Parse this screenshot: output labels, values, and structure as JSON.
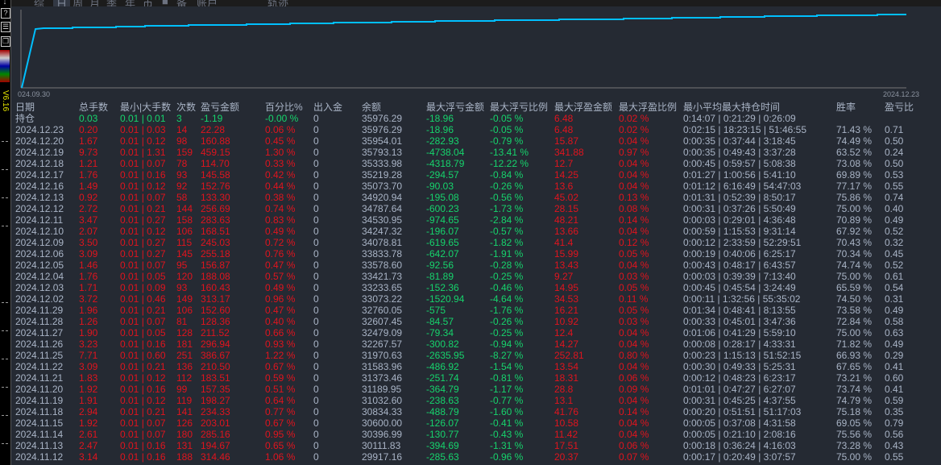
{
  "left_toolbar": {
    "icons": [
      "download-icon",
      "help-icon",
      "layout-icon",
      "window-icon"
    ],
    "version": "V6.16"
  },
  "tabs": [
    "综",
    "日",
    "周",
    "月",
    "季",
    "年",
    "币",
    "■",
    "备",
    "账户",
    "轨迹"
  ],
  "active_tab": "日",
  "chart": {
    "start_label": "024.09.30",
    "end_label": "2024.12.23",
    "line_color": "#00bfff"
  },
  "colors": {
    "profit": "#e0141e",
    "loss": "#16d36c",
    "text": "#a9b4c6",
    "background": "#252a33"
  },
  "table": {
    "headers": [
      "日期",
      "总手数",
      "最小|大手数",
      "次数",
      "盈亏金额",
      "百分比%",
      "出入金",
      "余额",
      "最大浮亏金额",
      "最大浮亏比例",
      "最大浮盈金额",
      "最大浮盈比例",
      "最小平均最大持仓时间",
      "胜率",
      "盈亏比"
    ],
    "rows": [
      [
        "持仓",
        "0.03",
        "0.01 | 0.01",
        "3",
        "-1.19",
        "-0.00 %",
        "0",
        "35976.29",
        "-18.96",
        "-0.05 %",
        "6.48",
        "0.02 %",
        "0:14:07 | 0:21:29 | 0:26:09",
        "",
        ""
      ],
      [
        "2024.12.23",
        "0.20",
        "0.01 | 0.03",
        "14",
        "22.28",
        "0.06 %",
        "0",
        "35976.29",
        "-18.96",
        "-0.05 %",
        "6.48",
        "0.02 %",
        "0:02:15 | 18:23:15 | 51:46:55",
        "71.43 %",
        "0.71"
      ],
      [
        "2024.12.20",
        "1.67",
        "0.01 | 0.12",
        "98",
        "160.88",
        "0.45 %",
        "0",
        "35954.01",
        "-282.93",
        "-0.79 %",
        "15.87",
        "0.04 %",
        "0:00:35 | 0:37:44 | 3:18:45",
        "74.49 %",
        "0.50"
      ],
      [
        "2024.12.19",
        "9.73",
        "0.01 | 1.31",
        "159",
        "459.15",
        "1.30 %",
        "0",
        "35793.13",
        "-4738.04",
        "-13.41 %",
        "341.88",
        "0.97 %",
        "0:00:35 | 0:49:43 | 3:37:28",
        "63.52 %",
        "0.24"
      ],
      [
        "2024.12.18",
        "1.21",
        "0.01 | 0.07",
        "78",
        "114.70",
        "0.33 %",
        "0",
        "35333.98",
        "-4318.79",
        "-12.22 %",
        "12.7",
        "0.04 %",
        "0:00:45 | 0:59:57 | 5:08:38",
        "73.08 %",
        "0.50"
      ],
      [
        "2024.12.17",
        "1.76",
        "0.01 | 0.16",
        "93",
        "145.58",
        "0.42 %",
        "0",
        "35219.28",
        "-294.57",
        "-0.84 %",
        "14.25",
        "0.04 %",
        "0:01:27 | 1:00:56 | 5:41:10",
        "69.89 %",
        "0.53"
      ],
      [
        "2024.12.16",
        "1.49",
        "0.01 | 0.12",
        "92",
        "152.76",
        "0.44 %",
        "0",
        "35073.70",
        "-90.03",
        "-0.26 %",
        "13.6",
        "0.04 %",
        "0:01:12 | 6:16:49 | 54:47:03",
        "77.17 %",
        "0.55"
      ],
      [
        "2024.12.13",
        "0.92",
        "0.01 | 0.07",
        "58",
        "133.30",
        "0.38 %",
        "0",
        "34920.94",
        "-195.08",
        "-0.56 %",
        "45.02",
        "0.13 %",
        "0:01:31 | 0:52:39 | 8:50:17",
        "75.86 %",
        "0.74"
      ],
      [
        "2024.12.12",
        "2.72",
        "0.01 | 0.21",
        "144",
        "256.69",
        "0.74 %",
        "0",
        "34787.64",
        "-600.23",
        "-1.73 %",
        "28.15",
        "0.08 %",
        "0:00:31 | 0:37:26 | 5:50:49",
        "75.00 %",
        "0.40"
      ],
      [
        "2024.12.11",
        "3.47",
        "0.01 | 0.27",
        "158",
        "283.63",
        "0.83 %",
        "0",
        "34530.95",
        "-974.65",
        "-2.84 %",
        "48.21",
        "0.14 %",
        "0:00:03 | 0:29:01 | 4:36:48",
        "70.89 %",
        "0.49"
      ],
      [
        "2024.12.10",
        "2.07",
        "0.01 | 0.12",
        "106",
        "168.51",
        "0.49 %",
        "0",
        "34247.32",
        "-196.07",
        "-0.57 %",
        "13.66",
        "0.04 %",
        "0:00:59 | 1:15:53 | 9:31:14",
        "67.92 %",
        "0.52"
      ],
      [
        "2024.12.09",
        "3.50",
        "0.01 | 0.27",
        "115",
        "245.03",
        "0.72 %",
        "0",
        "34078.81",
        "-619.65",
        "-1.82 %",
        "41.4",
        "0.12 %",
        "0:00:12 | 2:33:59 | 52:29:51",
        "70.43 %",
        "0.32"
      ],
      [
        "2024.12.06",
        "3.09",
        "0.01 | 0.27",
        "145",
        "255.18",
        "0.76 %",
        "0",
        "33833.78",
        "-642.07",
        "-1.91 %",
        "15.99",
        "0.05 %",
        "0:00:19 | 0:40:06 | 6:25:17",
        "70.34 %",
        "0.45"
      ],
      [
        "2024.12.05",
        "1.46",
        "0.01 | 0.07",
        "95",
        "156.87",
        "0.47 %",
        "0",
        "33578.60",
        "-92.56",
        "-0.28 %",
        "13.43",
        "0.04 %",
        "0:00:43 | 0:48:17 | 6:43:57",
        "74.74 %",
        "0.52"
      ],
      [
        "2024.12.04",
        "1.76",
        "0.01 | 0.05",
        "120",
        "188.08",
        "0.57 %",
        "0",
        "33421.73",
        "-81.89",
        "-0.25 %",
        "9.27",
        "0.03 %",
        "0:00:03 | 0:39:39 | 7:13:40",
        "75.00 %",
        "0.61"
      ],
      [
        "2024.12.03",
        "1.71",
        "0.01 | 0.09",
        "93",
        "160.43",
        "0.49 %",
        "0",
        "33233.65",
        "-152.36",
        "-0.46 %",
        "14.95",
        "0.05 %",
        "0:00:45 | 0:45:54 | 3:24:49",
        "65.59 %",
        "0.54"
      ],
      [
        "2024.12.02",
        "3.72",
        "0.01 | 0.46",
        "149",
        "313.17",
        "0.96 %",
        "0",
        "33073.22",
        "-1520.94",
        "-4.64 %",
        "34.53",
        "0.11 %",
        "0:00:11 | 1:32:56 | 55:35:02",
        "74.50 %",
        "0.31"
      ],
      [
        "2024.11.29",
        "1.96",
        "0.01 | 0.21",
        "106",
        "152.60",
        "0.47 %",
        "0",
        "32760.05",
        "-575",
        "-1.76 %",
        "16.21",
        "0.05 %",
        "0:01:34 | 0:48:41 | 8:13:55",
        "73.58 %",
        "0.49"
      ],
      [
        "2024.11.28",
        "1.26",
        "0.01 | 0.07",
        "81",
        "128.36",
        "0.40 %",
        "0",
        "32607.45",
        "-84.57",
        "-0.26 %",
        "10.92",
        "0.03 %",
        "0:00:33 | 0:45:01 | 3:47:36",
        "72.84 %",
        "0.58"
      ],
      [
        "2024.11.27",
        "1.90",
        "0.01 | 0.05",
        "128",
        "211.52",
        "0.66 %",
        "0",
        "32479.09",
        "-79.34",
        "-0.25 %",
        "12.4",
        "0.04 %",
        "0:01:06 | 0:41:29 | 5:59:10",
        "75.00 %",
        "0.63"
      ],
      [
        "2024.11.26",
        "3.23",
        "0.01 | 0.16",
        "181",
        "296.94",
        "0.93 %",
        "0",
        "32267.57",
        "-300.82",
        "-0.94 %",
        "14.27",
        "0.04 %",
        "0:00:08 | 0:28:17 | 4:33:31",
        "71.82 %",
        "0.49"
      ],
      [
        "2024.11.25",
        "7.71",
        "0.01 | 0.60",
        "251",
        "386.67",
        "1.22 %",
        "0",
        "31970.63",
        "-2635.95",
        "-8.27 %",
        "252.81",
        "0.80 %",
        "0:00:23 | 1:15:13 | 51:52:15",
        "66.93 %",
        "0.29"
      ],
      [
        "2024.11.22",
        "3.09",
        "0.01 | 0.21",
        "136",
        "210.50",
        "0.67 %",
        "0",
        "31583.96",
        "-486.92",
        "-1.54 %",
        "13.54",
        "0.04 %",
        "0:00:30 | 0:49:33 | 5:25:31",
        "67.65 %",
        "0.41"
      ],
      [
        "2024.11.21",
        "1.83",
        "0.01 | 0.12",
        "112",
        "183.51",
        "0.59 %",
        "0",
        "31373.46",
        "-251.74",
        "-0.81 %",
        "18.31",
        "0.06 %",
        "0:00:12 | 0:48:23 | 6:23:17",
        "73.21 %",
        "0.60"
      ],
      [
        "2024.11.20",
        "1.92",
        "0.01 | 0.16",
        "99",
        "157.35",
        "0.51 %",
        "0",
        "31189.95",
        "-364.79",
        "-1.17 %",
        "28.8",
        "0.09 %",
        "0:01:01 | 0:47:27 | 6:27:07",
        "73.74 %",
        "0.41"
      ],
      [
        "2024.11.19",
        "1.91",
        "0.01 | 0.12",
        "119",
        "198.27",
        "0.64 %",
        "0",
        "31032.60",
        "-238.63",
        "-0.77 %",
        "13.1",
        "0.04 %",
        "0:00:31 | 0:45:25 | 4:37:55",
        "74.79 %",
        "0.59"
      ],
      [
        "2024.11.18",
        "2.94",
        "0.01 | 0.21",
        "141",
        "234.33",
        "0.77 %",
        "0",
        "30834.33",
        "-488.79",
        "-1.60 %",
        "41.76",
        "0.14 %",
        "0:00:20 | 0:51:51 | 51:17:03",
        "75.18 %",
        "0.35"
      ],
      [
        "2024.11.15",
        "1.92",
        "0.01 | 0.07",
        "126",
        "203.01",
        "0.67 %",
        "0",
        "30600.00",
        "-126.07",
        "-0.41 %",
        "10.58",
        "0.04 %",
        "0:00:05 | 0:37:08 | 4:31:58",
        "69.05 %",
        "0.79"
      ],
      [
        "2024.11.14",
        "2.61",
        "0.01 | 0.07",
        "180",
        "285.16",
        "0.95 %",
        "0",
        "30396.99",
        "-130.77",
        "-0.43 %",
        "11.42",
        "0.04 %",
        "0:00:05 | 0:21:10 | 2:08:16",
        "75.56 %",
        "0.56"
      ],
      [
        "2024.11.13",
        "2.47",
        "0.01 | 0.16",
        "131",
        "194.67",
        "0.65 %",
        "0",
        "30111.83",
        "-394.69",
        "-1.31 %",
        "17.51",
        "0.06 %",
        "0:00:18 | 0:36:24 | 4:16:03",
        "73.28 %",
        "0.43"
      ],
      [
        "2024.11.12",
        "3.14",
        "0.01 | 0.16",
        "188",
        "314.46",
        "1.06 %",
        "0",
        "29917.16",
        "-285.63",
        "-0.96 %",
        "20.37",
        "0.07 %",
        "0:00:17 | 0:20:49 | 3:07:57",
        "75.00 %",
        "0.55"
      ]
    ]
  }
}
